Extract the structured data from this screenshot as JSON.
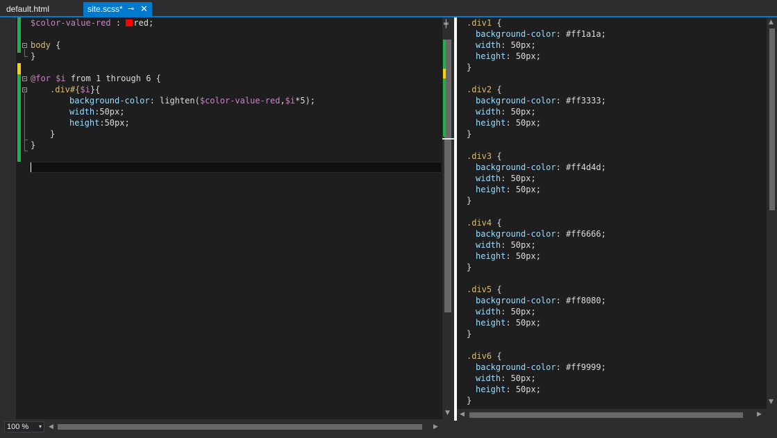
{
  "tabs": [
    {
      "label": "default.html",
      "active": false
    },
    {
      "label": "site.scss*",
      "active": true,
      "pin_glyph": "⊸",
      "close_glyph": "✕"
    }
  ],
  "colors": {
    "accent": "#007acc",
    "swatch": "#ff0000",
    "change_green": "#22b04b",
    "change_yellow": "#f9d100"
  },
  "scss": {
    "line1": {
      "var": "$color-value-red",
      "sep": " : ",
      "value": "red;"
    },
    "body_open": {
      "sel": "body",
      "brace": " {"
    },
    "body_close": "}",
    "for_line": {
      "kw": "@for",
      "var": "$i",
      "text": " from 1 through 6 {"
    },
    "div_line": {
      "sel": ".div#{",
      "var": "$i",
      "close": "}{"
    },
    "bg_line": {
      "prop": "background-color",
      "fn": ": lighten(",
      "var1": "$color-value-red",
      "comma": ",",
      "var2": "$i",
      "rest": "*5);"
    },
    "width_line": {
      "prop": "width",
      "rest": ":50px;"
    },
    "height_line": {
      "prop": "height",
      "rest": ":50px;"
    },
    "inner_close": "}",
    "outer_close": "}"
  },
  "css_output": [
    {
      "selector": ".div1",
      "bg": "#ff1a1a;",
      "width": "50px;",
      "height": "50px;"
    },
    {
      "selector": ".div2",
      "bg": "#ff3333;",
      "width": "50px;",
      "height": "50px;"
    },
    {
      "selector": ".div3",
      "bg": "#ff4d4d;",
      "width": "50px;",
      "height": "50px;"
    },
    {
      "selector": ".div4",
      "bg": "#ff6666;",
      "width": "50px;",
      "height": "50px;"
    },
    {
      "selector": ".div5",
      "bg": "#ff8080;",
      "width": "50px;",
      "height": "50px;"
    },
    {
      "selector": ".div6",
      "bg": "#ff9999;",
      "width": "50px;",
      "height": "50px;"
    }
  ],
  "css_labels": {
    "bg_prop": "background-color",
    "width_prop": "width",
    "height_prop": "height",
    "sep": ": ",
    "open": " {",
    "close": "}"
  },
  "zoom": {
    "value": "100 %",
    "dropdown_glyph": "▾"
  },
  "icons": {
    "split": "splitter-icon",
    "up": "▲",
    "down": "▼",
    "left": "◀",
    "right": "▶"
  }
}
